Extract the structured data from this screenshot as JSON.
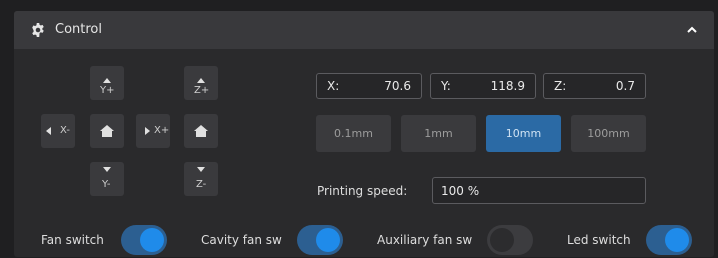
{
  "header": {
    "title": "Control",
    "icon": "gear-icon",
    "collapse_icon": "chevron-up-icon"
  },
  "jog": {
    "y_plus": "Y+",
    "y_minus": "Y-",
    "x_minus": "X-",
    "x_plus": "X+",
    "z_plus": "Z+",
    "z_minus": "Z-"
  },
  "coords": [
    {
      "label": "X:",
      "value": "70.6"
    },
    {
      "label": "Y:",
      "value": "118.9"
    },
    {
      "label": "Z:",
      "value": "0.7"
    }
  ],
  "steps": [
    {
      "label": "0.1mm",
      "active": false
    },
    {
      "label": "1mm",
      "active": false
    },
    {
      "label": "10mm",
      "active": true
    },
    {
      "label": "100mm",
      "active": false
    }
  ],
  "speed": {
    "label": "Printing speed:",
    "value": "100 %"
  },
  "switches": [
    {
      "label": "Fan switch",
      "on": true
    },
    {
      "label": "Cavity fan sw",
      "on": true
    },
    {
      "label": "Auxiliary fan sw",
      "on": false
    },
    {
      "label": "Led switch",
      "on": true
    }
  ],
  "colors": {
    "accent": "#1f8bea",
    "active_step": "#2b6aa5",
    "panel": "#2a2a2c",
    "header": "#39393c"
  }
}
